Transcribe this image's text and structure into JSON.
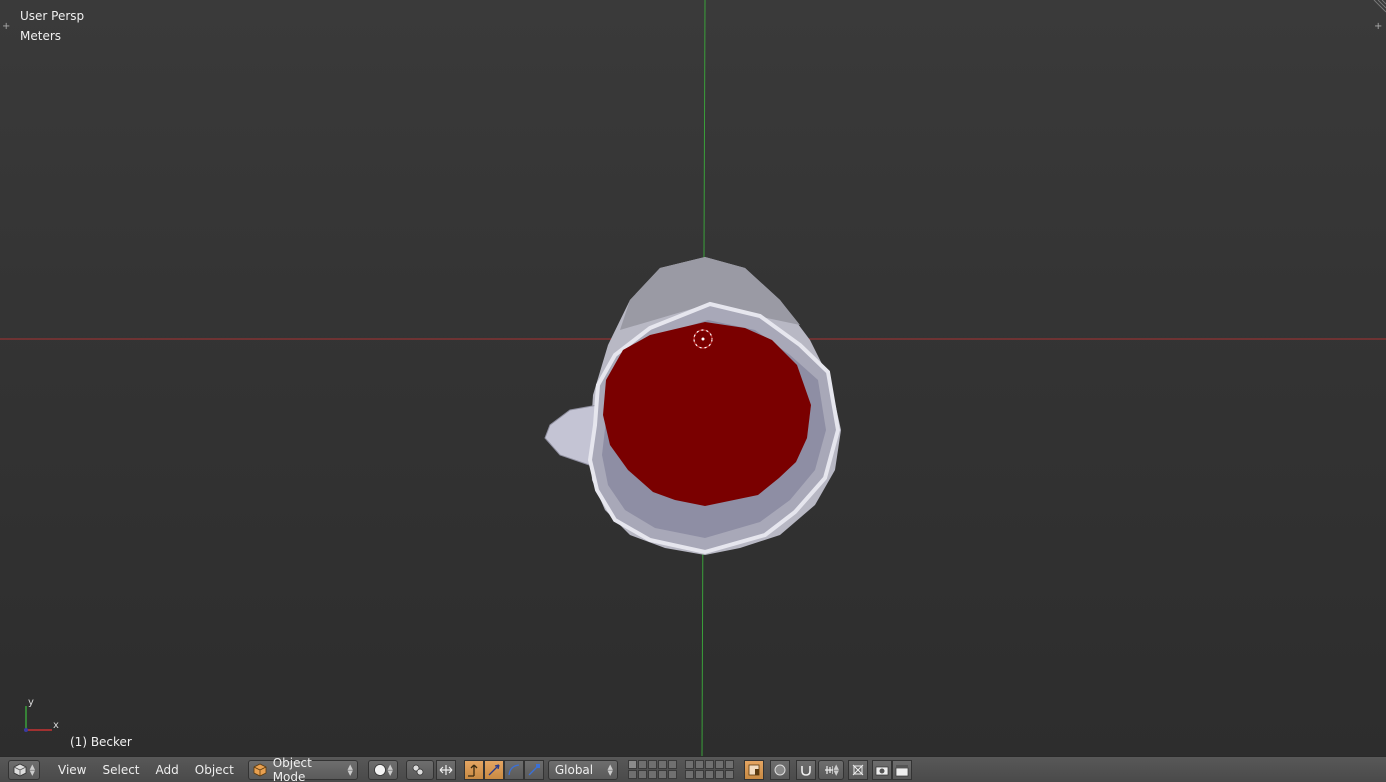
{
  "viewport": {
    "view_name": "User Persp",
    "units": "Meters",
    "object_info": "(1) Becker",
    "axis_labels": {
      "y": "y",
      "x": "x"
    },
    "colors": {
      "x_axis": "#a83232",
      "y_axis": "#3aa03a",
      "liquid": "#7a0000"
    }
  },
  "header": {
    "editor_icon": "3d-view-icon",
    "menus": [
      "View",
      "Select",
      "Add",
      "Object"
    ],
    "mode": "Object Mode",
    "pivot": "Global",
    "accent": "#d8964f"
  }
}
